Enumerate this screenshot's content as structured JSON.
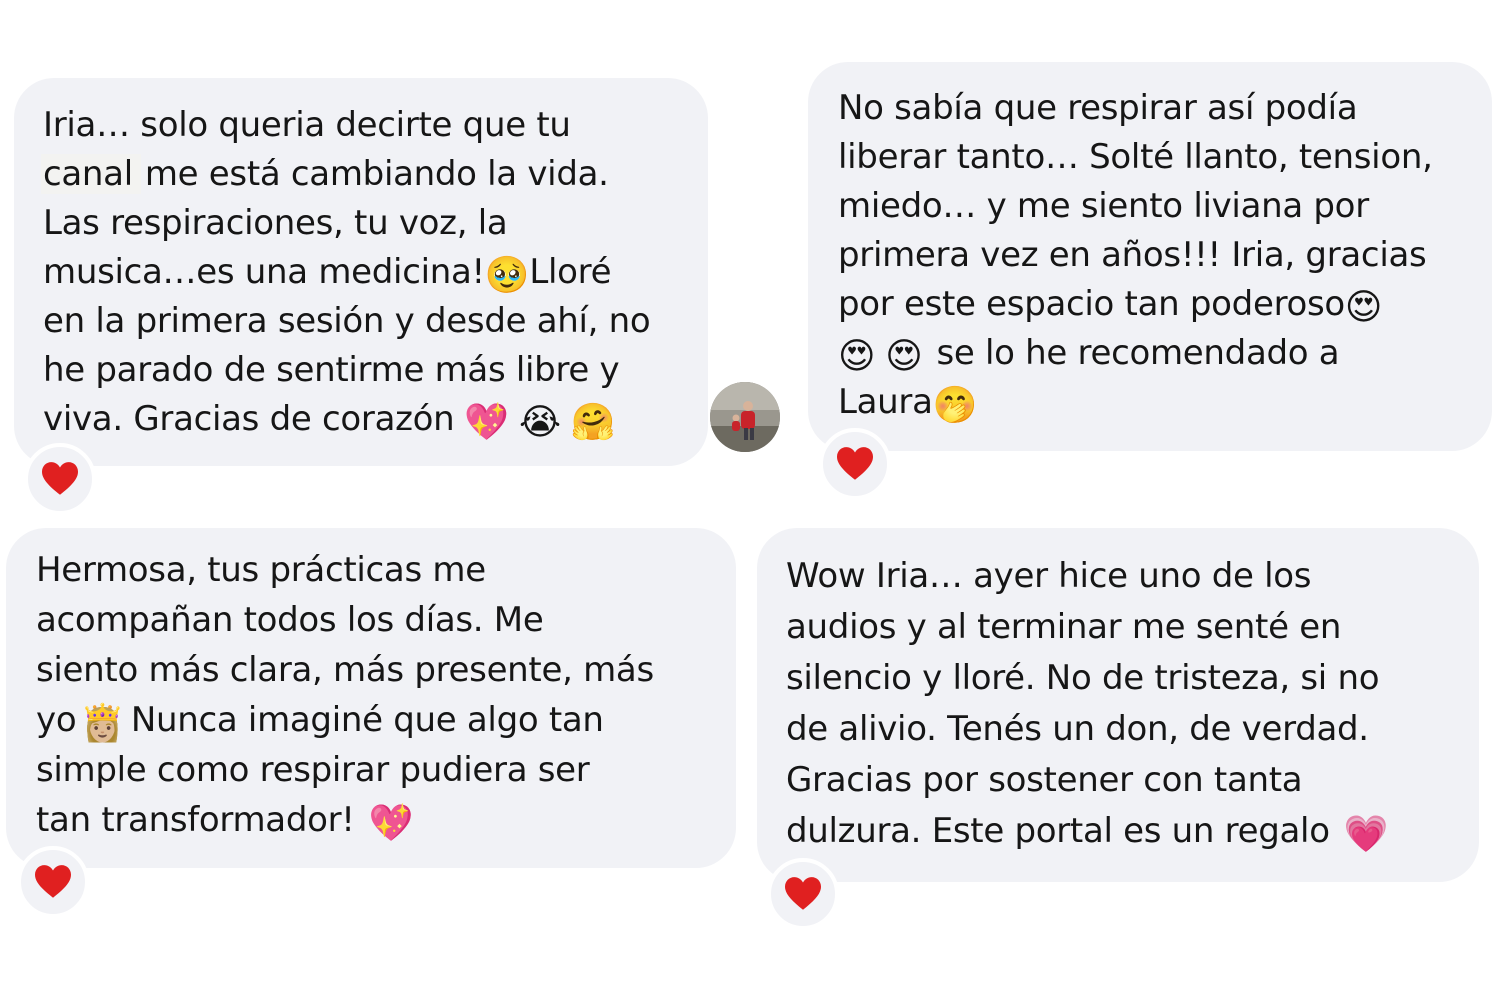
{
  "colors": {
    "bubble_bg": "#f1f2f6",
    "text": "#161616",
    "heart": "#e02020",
    "page_bg": "#ffffff"
  },
  "messages": [
    {
      "lines": [
        "Iria… solo queria decirte que tu",
        "canal",
        "me está cambiando la vida.",
        "Las respiraciones, tu voz, la",
        "musica…es una medicina!",
        "🥹",
        "Lloré",
        "en la primera sesión y desde ahí, no",
        "he parado de sentirme más libre y",
        "viva. Gracias de corazón",
        "💖",
        "😭",
        "🤗"
      ],
      "reaction": "heart-icon"
    },
    {
      "lines": [
        "No sabía que respirar así podía",
        "liberar tanto… Solté llanto, tension,",
        "miedo… y me siento liviana por",
        "primera vez en años!!! Iria, gracias",
        "por este espacio tan poderoso",
        "😍",
        "😍",
        "😍",
        "se lo he recomendado a",
        "Laura",
        "🤭"
      ],
      "reaction": "heart-icon"
    },
    {
      "lines": [
        "Hermosa, tus prácticas me",
        "acompañan todos los días. Me",
        "siento más clara, más presente, más",
        "yo",
        "👸🏼",
        "Nunca imaginé que algo tan",
        "simple como respirar pudiera ser",
        "tan transformador!",
        "💖"
      ],
      "reaction": "heart-icon"
    },
    {
      "lines": [
        "Wow Iria… ayer hice uno de los",
        "audios y al terminar me senté en",
        "silencio y lloré. No de tristeza, si no",
        "de alivio. Tenés un don, de verdad.",
        "Gracias por sostener con tanta",
        "dulzura. Este portal es un regalo",
        "💗"
      ],
      "reaction": "heart-icon"
    }
  ],
  "avatar": {
    "icon": "contact-photo"
  }
}
